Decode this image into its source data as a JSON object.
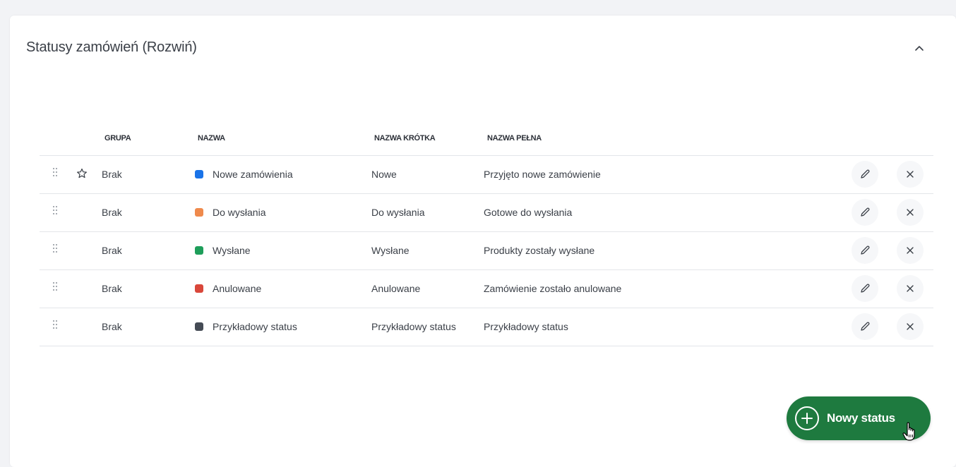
{
  "panel": {
    "title": "Statusy zamówień (Rozwiń)"
  },
  "table": {
    "headers": {
      "group": "GRUPA",
      "name": "NAZWA",
      "short_name": "NAZWA KRÓTKA",
      "full_name": "NAZWA PEŁNA"
    },
    "rows": [
      {
        "group": "Brak",
        "name": "Nowe zamówienia",
        "short_name": "Nowe",
        "full_name": "Przyjęto nowe zamówienie",
        "color": "#1a73e8",
        "starred": true
      },
      {
        "group": "Brak",
        "name": "Do wysłania",
        "short_name": "Do wysłania",
        "full_name": "Gotowe do wysłania",
        "color": "#ef8a4c",
        "starred": false
      },
      {
        "group": "Brak",
        "name": "Wysłane",
        "short_name": "Wysłane",
        "full_name": "Produkty zostały wysłane",
        "color": "#1e9e5a",
        "starred": false
      },
      {
        "group": "Brak",
        "name": "Anulowane",
        "short_name": "Anulowane",
        "full_name": "Zamówienie zostało anulowane",
        "color": "#d9473a",
        "starred": false
      },
      {
        "group": "Brak",
        "name": "Przykładowy status",
        "short_name": "Przykładowy status",
        "full_name": "Przykładowy status",
        "color": "#454b55",
        "starred": false
      }
    ]
  },
  "actions": {
    "new_status_label": "Nowy status"
  },
  "icons": {
    "collapse": "chevron-up-icon",
    "drag": "drag-handle-icon",
    "star": "star-outline-icon",
    "edit": "pencil-icon",
    "delete": "close-icon",
    "add": "plus-circle-icon",
    "cursor": "hand-pointer-icon"
  },
  "colors": {
    "primary_button": "#1e7a3f"
  }
}
